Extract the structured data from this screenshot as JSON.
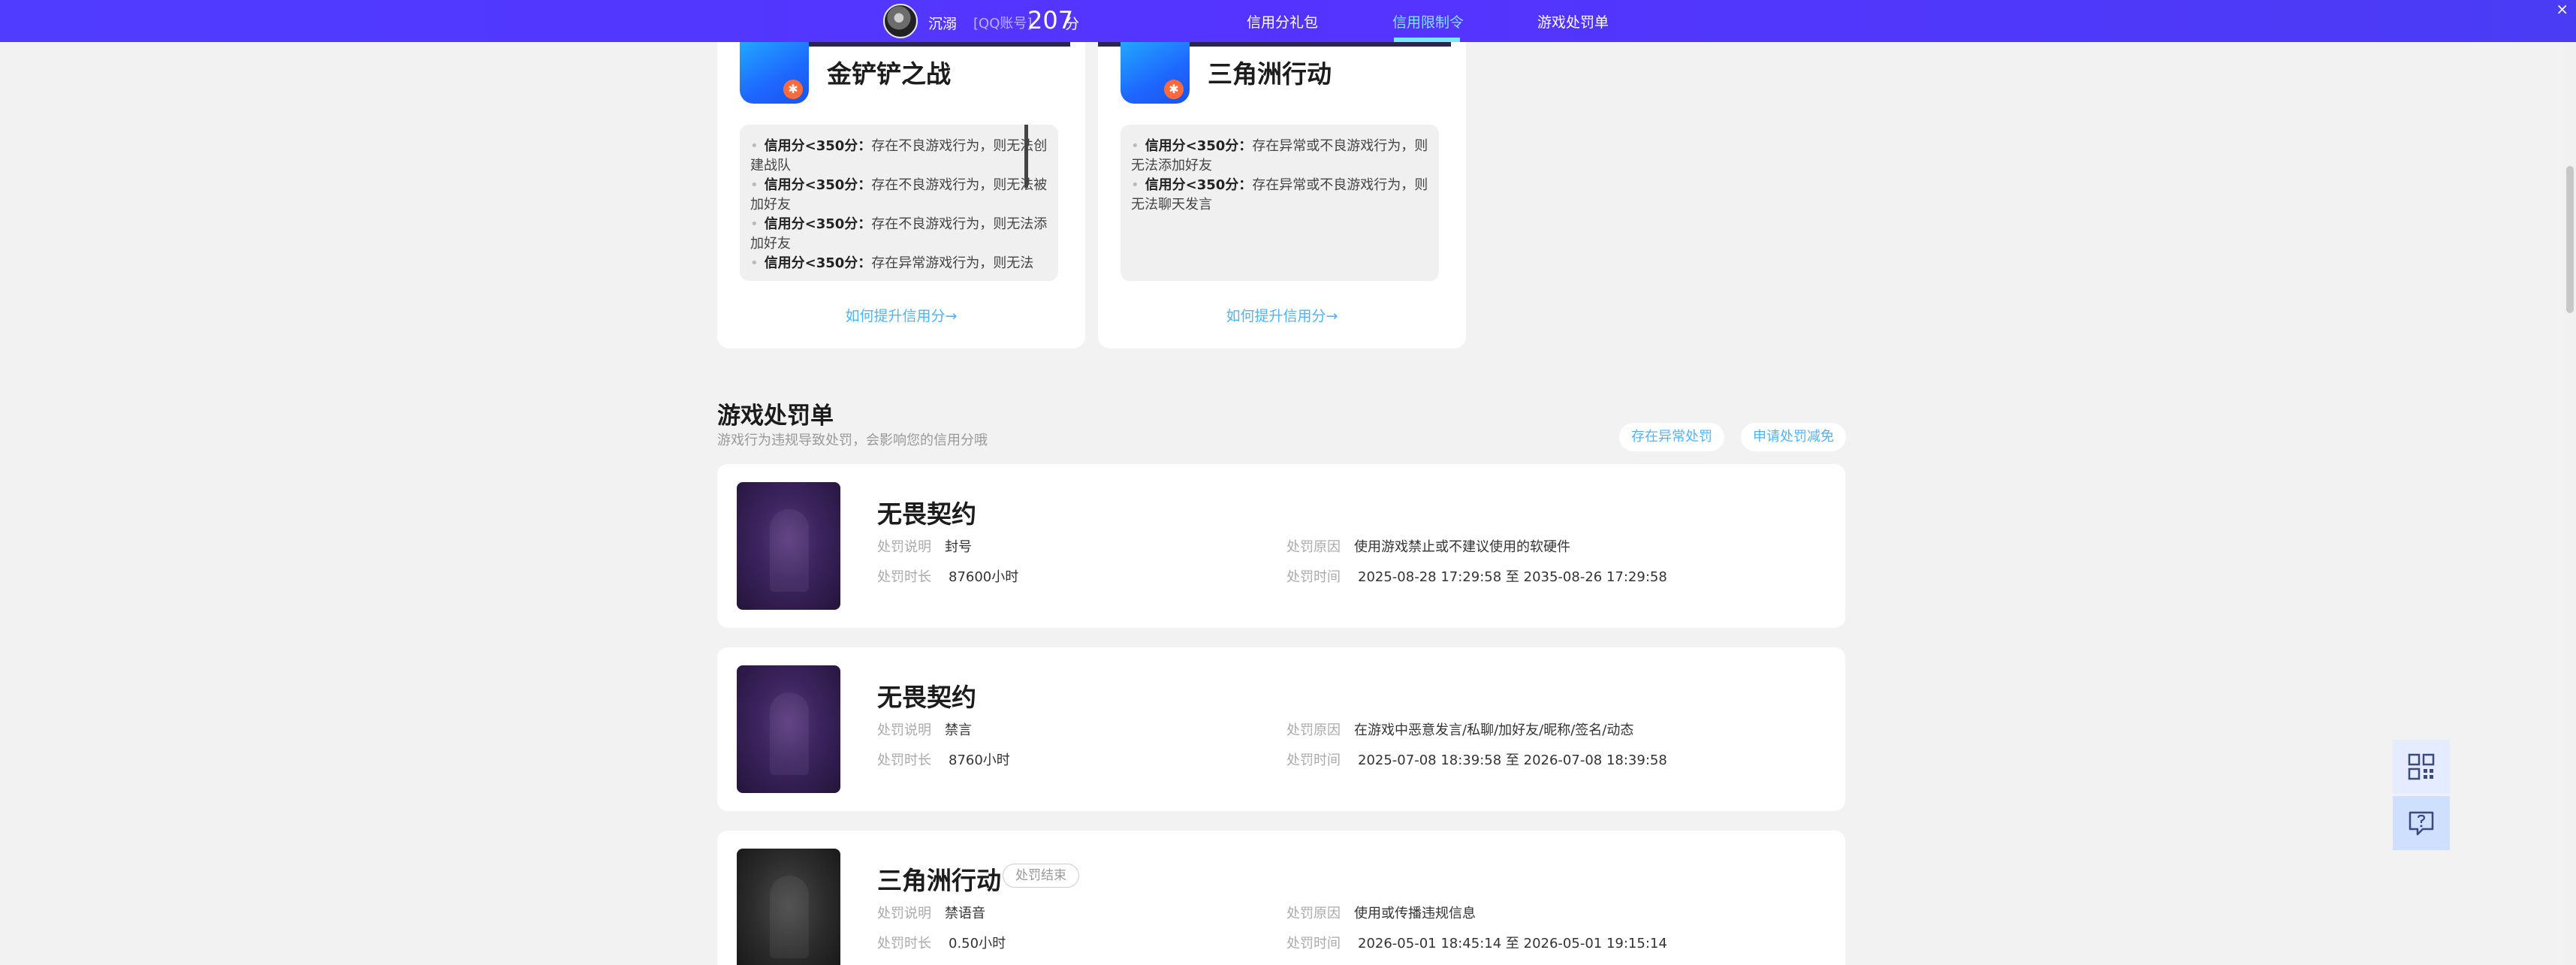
{
  "header": {
    "username": "沉溺",
    "account_type": "[QQ账号]",
    "score": "207",
    "score_unit": "分",
    "nav": [
      {
        "label": "信用分礼包",
        "active": false
      },
      {
        "label": "信用限制令",
        "active": true
      },
      {
        "label": "游戏处罚单",
        "active": false
      }
    ],
    "accent_color": "#5133ff",
    "active_color": "#7ee4ff"
  },
  "credit_cards": [
    {
      "game": "金铲铲之战",
      "rules": [
        {
          "bold": "信用分<350分：",
          "text": "存在不良游戏行为，则无法创建战队"
        },
        {
          "bold": "信用分<350分：",
          "text": "存在不良游戏行为，则无法被加好友"
        },
        {
          "bold": "信用分<350分：",
          "text": "存在不良游戏行为，则无法添加好友"
        },
        {
          "bold": "信用分<350分：",
          "text": "存在异常游戏行为，则无法"
        }
      ],
      "improve_link": "如何提升信用分→"
    },
    {
      "game": "三角洲行动",
      "rules": [
        {
          "bold": "信用分<350分：",
          "text": "存在异常或不良游戏行为，则无法添加好友"
        },
        {
          "bold": "信用分<350分：",
          "text": "存在异常或不良游戏行为，则无法聊天发言"
        }
      ],
      "improve_link": "如何提升信用分→"
    }
  ],
  "punishments": {
    "title": "游戏处罚单",
    "subtitle": "游戏行为违规导致处罚，会影响您的信用分哦",
    "actions": [
      "存在异常处罚",
      "申请处罚减免"
    ],
    "labels": {
      "desc": "处罚说明",
      "duration": "处罚时长",
      "reason": "处罚原因",
      "time": "处罚时间"
    },
    "items": [
      {
        "game": "无畏契约",
        "tag": "",
        "desc": "封号",
        "duration": "87600小时",
        "reason": "使用游戏禁止或不建议使用的软硬件",
        "time": "2025-08-28 17:29:58 至 2035-08-26 17:29:58",
        "thumb": "purple"
      },
      {
        "game": "无畏契约",
        "tag": "",
        "desc": "禁言",
        "duration": "8760小时",
        "reason": "在游戏中恶意发言/私聊/加好友/昵称/签名/动态",
        "time": "2025-07-08 18:39:58 至 2026-07-08 18:39:58",
        "thumb": "purple"
      },
      {
        "game": "三角洲行动",
        "tag": "处罚结束",
        "desc": "禁语音",
        "duration": "0.50小时",
        "reason": "使用或传播违规信息",
        "time": "2026-05-01 18:45:14 至 2026-05-01 19:15:14",
        "thumb": "gray"
      }
    ]
  },
  "side_buttons": [
    {
      "icon": "qrcode-icon"
    },
    {
      "icon": "feedback-icon"
    }
  ]
}
